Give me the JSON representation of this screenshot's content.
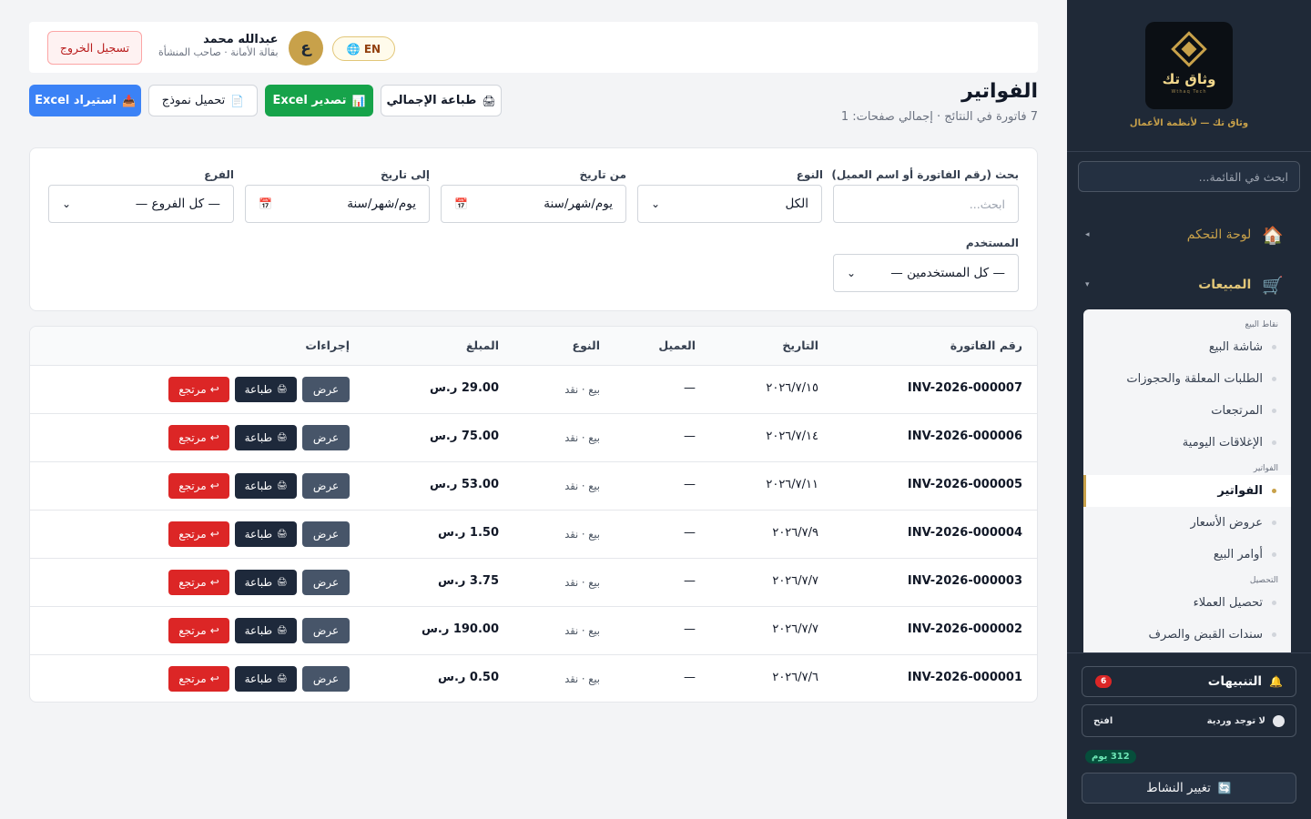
{
  "sidebar": {
    "logo_name": "وثاق تك",
    "logo_tag": "Wthaq Tech",
    "tagline": "وثاق تك — لأنظمة الأعمال",
    "search_placeholder": "ابحث في القائمة...",
    "dashboard_label": "لوحة التحكم",
    "dashboard_icon": "🏠",
    "sales_label": "المبيعات",
    "sales_icon": "🛒",
    "sections": [
      {
        "title": "نقاط البيع",
        "items": [
          "شاشة البيع",
          "الطلبات المعلقة والحجوزات",
          "المرتجعات",
          "الإغلاقات اليومية"
        ]
      },
      {
        "title": "الفواتير",
        "items": [
          "الفواتير",
          "عروض الأسعار",
          "أوامر البيع"
        ]
      },
      {
        "title": "التحصيل",
        "items": [
          "تحصيل العملاء",
          "سندات القبض والصرف"
        ]
      }
    ],
    "alerts_label": "التنبيهات",
    "alerts_icon": "🔔",
    "alerts_count": "6",
    "shift_label": "لا توجد وردية",
    "shift_open": "افتح",
    "days_badge": "312 يوم",
    "change_activity": "تغيير النشاط",
    "change_icon": "🔄"
  },
  "header": {
    "logout": "تسجيل الخروج",
    "user_name": "عبدالله محمد",
    "user_role": "بقالة الأمانة · صاحب المنشأة",
    "avatar_letter": "ع",
    "lang": "EN"
  },
  "page": {
    "title": "الفواتير",
    "subtitle": "7 فاتورة في النتائج · إجمالي صفحات: 1",
    "print_all": "طباعة الإجمالي",
    "export_excel": "تصدير Excel",
    "load_template": "تحميل نموذج",
    "import_excel": "استيراد Excel"
  },
  "filters": {
    "search_label": "بحث (رقم الفاتورة أو اسم العميل)",
    "search_placeholder": "ابحث...",
    "type_label": "النوع",
    "type_value": "الكل",
    "from_label": "من تاريخ",
    "from_value": "يوم/شهر/سنة",
    "to_label": "إلى تاريخ",
    "to_value": "يوم/شهر/سنة",
    "branch_label": "الفرع",
    "branch_value": "— كل الفروع —",
    "user_label": "المستخدم",
    "user_value": "— كل المستخدمين —"
  },
  "table": {
    "headers": {
      "invoice": "رقم الفاتورة",
      "date": "التاريخ",
      "customer": "العميل",
      "type": "النوع",
      "amount": "المبلغ",
      "actions": "إجراءات"
    },
    "view_label": "عرض",
    "print_label": "طباعة",
    "return_label": "مرتجع",
    "rows": [
      {
        "invoice": "INV-2026-000007",
        "date": "٢٠٢٦/٧/١٥",
        "customer": "—",
        "type": "بيع · نقد",
        "amount": "29.00 ر.س"
      },
      {
        "invoice": "INV-2026-000006",
        "date": "٢٠٢٦/٧/١٤",
        "customer": "—",
        "type": "بيع · نقد",
        "amount": "75.00 ر.س"
      },
      {
        "invoice": "INV-2026-000005",
        "date": "٢٠٢٦/٧/١١",
        "customer": "—",
        "type": "بيع · نقد",
        "amount": "53.00 ر.س"
      },
      {
        "invoice": "INV-2026-000004",
        "date": "٢٠٢٦/٧/٩",
        "customer": "—",
        "type": "بيع · نقد",
        "amount": "1.50 ر.س"
      },
      {
        "invoice": "INV-2026-000003",
        "date": "٢٠٢٦/٧/٧",
        "customer": "—",
        "type": "بيع · نقد",
        "amount": "3.75 ر.س"
      },
      {
        "invoice": "INV-2026-000002",
        "date": "٢٠٢٦/٧/٧",
        "customer": "—",
        "type": "بيع · نقد",
        "amount": "190.00 ر.س"
      },
      {
        "invoice": "INV-2026-000001",
        "date": "٢٠٢٦/٧/٦",
        "customer": "—",
        "type": "بيع · نقد",
        "amount": "0.50 ر.س"
      }
    ]
  },
  "colors": {
    "accent": "#c8a14a",
    "sidebar": "#1f2937",
    "danger": "#dc2626",
    "success": "#16a34a",
    "primary": "#3b82f6"
  }
}
